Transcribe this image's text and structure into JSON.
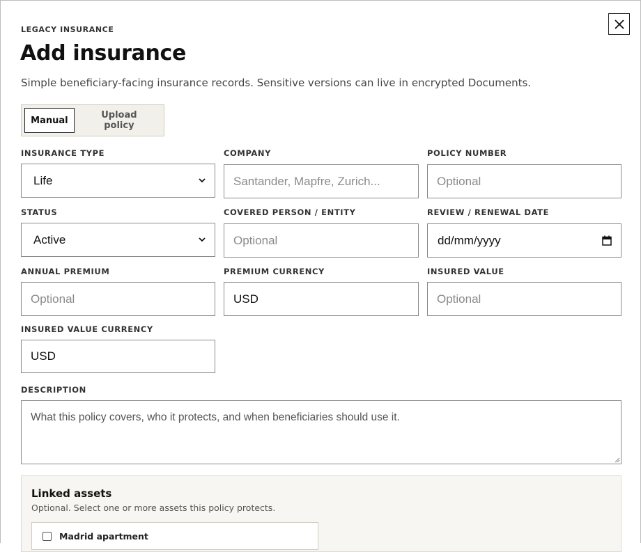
{
  "modal": {
    "eyebrow": "LEGACY INSURANCE",
    "title": "Add insurance",
    "subtitle": "Simple beneficiary-facing insurance records. Sensitive versions can live in encrypted Documents.",
    "close_icon": "close-icon"
  },
  "tabs": [
    {
      "label": "Manual",
      "active": true
    },
    {
      "label": "Upload policy",
      "active": false
    }
  ],
  "fields": {
    "insurance_type": {
      "label": "INSURANCE TYPE",
      "value": "Life"
    },
    "company": {
      "label": "COMPANY",
      "placeholder": "Santander, Mapfre, Zurich..."
    },
    "policy_number": {
      "label": "POLICY NUMBER",
      "placeholder": "Optional"
    },
    "status": {
      "label": "STATUS",
      "value": "Active"
    },
    "covered_person": {
      "label": "COVERED PERSON / ENTITY",
      "placeholder": "Optional"
    },
    "review_date": {
      "label": "REVIEW / RENEWAL DATE",
      "placeholder": "dd/mm/yyyy"
    },
    "annual_premium": {
      "label": "ANNUAL PREMIUM",
      "placeholder": "Optional"
    },
    "premium_currency": {
      "label": "PREMIUM CURRENCY",
      "value": "USD"
    },
    "insured_value": {
      "label": "INSURED VALUE",
      "placeholder": "Optional"
    },
    "insured_value_currency": {
      "label": "INSURED VALUE CURRENCY",
      "value": "USD"
    },
    "description": {
      "label": "DESCRIPTION",
      "placeholder": "What this policy covers, who it protects, and when beneficiaries should use it."
    }
  },
  "linked_assets": {
    "title": "Linked assets",
    "subtitle": "Optional. Select one or more assets this policy protects.",
    "items": [
      {
        "label": "Madrid apartment",
        "checked": false
      }
    ]
  },
  "colors": {
    "border": "#8a8a8a",
    "panel_bg": "#f7f6f2",
    "tab_bg": "#f2f0eb",
    "placeholder": "#8a8a8a"
  }
}
